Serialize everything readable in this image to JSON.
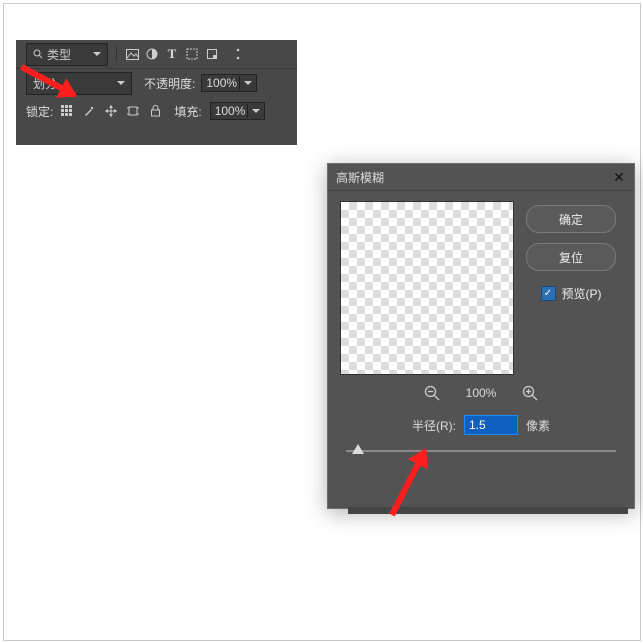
{
  "layers": {
    "search_label": "类型",
    "blend_mode": "划分",
    "opacity_label": "不透明度:",
    "opacity_value": "100%",
    "lock_label": "锁定:",
    "fill_label": "填充:",
    "fill_value": "100%"
  },
  "dialog": {
    "title": "高斯模糊",
    "ok_label": "确定",
    "reset_label": "复位",
    "preview_label": "预览(P)",
    "zoom_value": "100%",
    "radius_label": "半径(R):",
    "radius_value": "1.5",
    "radius_unit": "像素",
    "close_symbol": "✕"
  },
  "icons": {
    "search": "search-icon",
    "image": "image-filter-icon",
    "adjust": "adjustment-icon",
    "text": "text-icon",
    "shape": "shape-icon",
    "smart": "smartobject-icon",
    "overflow": "overflow-icon",
    "brush": "brush-icon",
    "move": "move-icon",
    "artboard": "artboard-icon",
    "lockpad": "lock-icon",
    "checkmark": "✓"
  }
}
